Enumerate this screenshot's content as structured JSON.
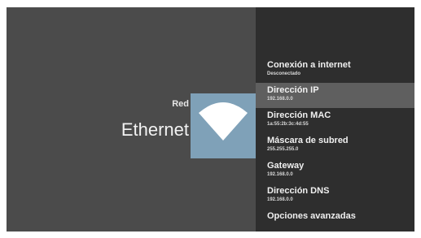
{
  "header": {
    "section": "Red",
    "title": "Ethernet"
  },
  "icon": {
    "name": "wifi-icon",
    "tile_color": "#7fa1b8",
    "glyph_color": "#ffffff"
  },
  "menu": {
    "items": [
      {
        "title": "Conexión a internet",
        "value": "Desconectado"
      },
      {
        "title": "Dirección IP",
        "value": "192.168.0.0"
      },
      {
        "title": "Dirección MAC",
        "value": "1a:55:2b:3c:4d:55"
      },
      {
        "title": "Máscara de subred",
        "value": "255.255.255.0"
      },
      {
        "title": "Gateway",
        "value": "192.168.0.0"
      },
      {
        "title": "Dirección DNS",
        "value": "192.168.0.0"
      },
      {
        "title": "Opciones avanzadas"
      }
    ],
    "selected_index": 1
  }
}
